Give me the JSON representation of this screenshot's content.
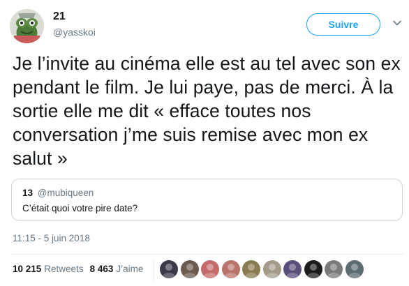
{
  "author": {
    "display_name": "21",
    "handle": "@yasskoi",
    "avatar_icon": "frog-avatar-icon"
  },
  "follow_label": "Suivre",
  "tweet_text": "Je l’invite au cinéma elle est au tel avec son ex pendant le film. Je lui paye, pas de merci. À la sortie elle me dit « efface toutes nos conversation j’me suis remise avec mon ex salut »",
  "quoted": {
    "display_name": "13",
    "handle": "@mubiqueen",
    "text": "C’était quoi votre pire date?"
  },
  "timestamp": "11:15 - 5 juin 2018",
  "stats": {
    "retweets_count": "10 215",
    "retweets_label": "Retweets",
    "likes_count": "8 463",
    "likes_label": "J’aime"
  },
  "likers": [
    {
      "color": "#3a3a4a"
    },
    {
      "color": "#6b5a4e"
    },
    {
      "color": "#c46a6a"
    },
    {
      "color": "#b9736b"
    },
    {
      "color": "#8a7a4f"
    },
    {
      "color": "#a39a8a"
    },
    {
      "color": "#5a4e7a"
    },
    {
      "color": "#1c1c1c"
    },
    {
      "color": "#7a7a7a"
    },
    {
      "color": "#5c6b70"
    }
  ],
  "colors": {
    "accent": "#1da1f2",
    "text": "#14171a",
    "secondary": "#657786",
    "border": "#ccd6dd"
  }
}
